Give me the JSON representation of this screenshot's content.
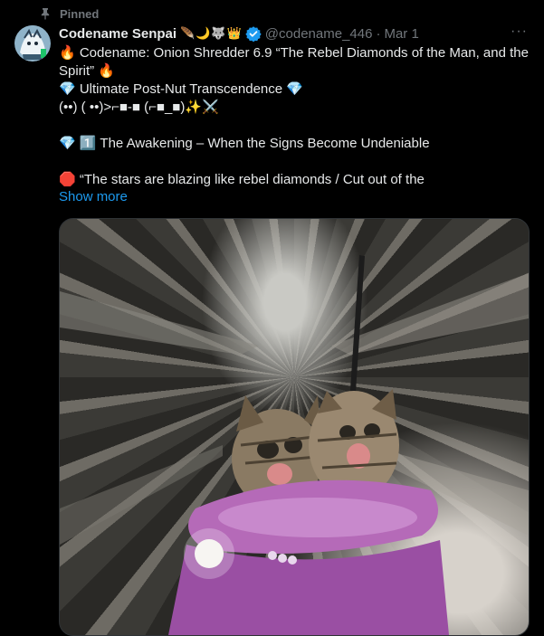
{
  "pinned_label": "Pinned",
  "author": {
    "display_name": "Codename Senpai",
    "name_emoji": "🪶🌙🐺👑",
    "handle": "@codename_446",
    "date": "Mar 1"
  },
  "more_label": "···",
  "body_lines": [
    "🔥 Codename: Onion Shredder 6.9 “The Rebel Diamonds of the Man, and the Spirit” 🔥",
    "💎 Ultimate Post-Nut Transcendence 💎",
    "(••) ( ••)>⌐■-■ (⌐■_■)✨⚔️",
    "",
    "💎 1️⃣ The Awakening – When the Signs Become Undeniable",
    "",
    "🛑 “The stars are blazing like rebel diamonds / Cut out of the"
  ],
  "show_more_label": "Show more",
  "colors": {
    "background": "#000000",
    "text": "#e7e9ea",
    "secondary": "#71767b",
    "link": "#1d9bf0",
    "verified": "#1d9bf0"
  },
  "media": {
    "icon": "kittens-bumper-car-gif"
  }
}
